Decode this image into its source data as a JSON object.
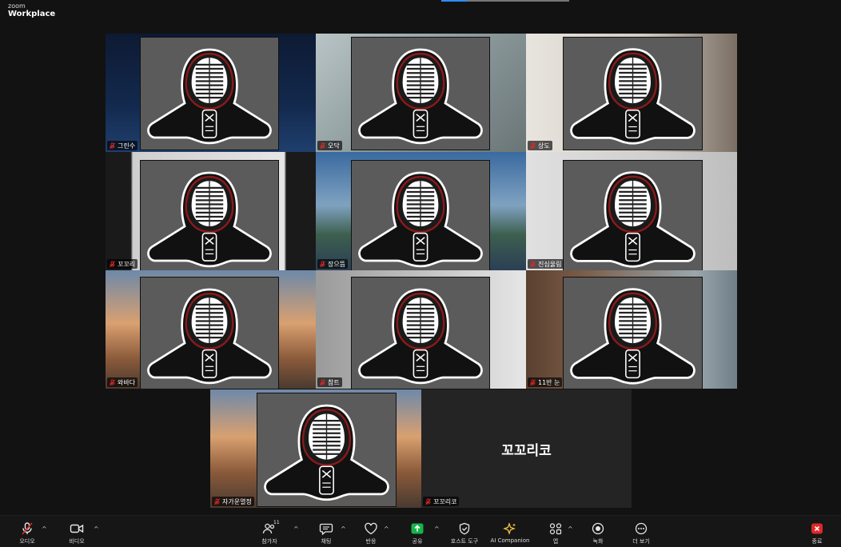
{
  "app": {
    "brand_small": "zoom",
    "brand_name": "Workplace"
  },
  "participants": [
    {
      "name": "그린수"
    },
    {
      "name": "오닥"
    },
    {
      "name": "상도",
      "active": true
    },
    {
      "name": "꼬꼬리"
    },
    {
      "name": "장으뜸"
    },
    {
      "name": "진심울림"
    },
    {
      "name": "와바다"
    },
    {
      "name": "참트"
    },
    {
      "name": "11반 눈"
    },
    {
      "name": "자가운열정"
    },
    {
      "name": "꼬꼬리코",
      "video_off": true
    }
  ],
  "video_off_display_name": "꼬꼬리코",
  "toolbar": {
    "audio": "오디오",
    "video": "비디오",
    "participants": "참가자",
    "participants_count": "11",
    "chat": "채팅",
    "react": "반응",
    "share": "공유",
    "host_tools": "호스트 도구",
    "ai_companion": "AI Companion",
    "apps": "앱",
    "record": "녹화",
    "more": "더 보기",
    "end": "종료"
  },
  "colors": {
    "active_speaker": "#25d35a",
    "share_green": "#16b34a",
    "end_red": "#e02828",
    "mic_muted": "#e02828"
  }
}
